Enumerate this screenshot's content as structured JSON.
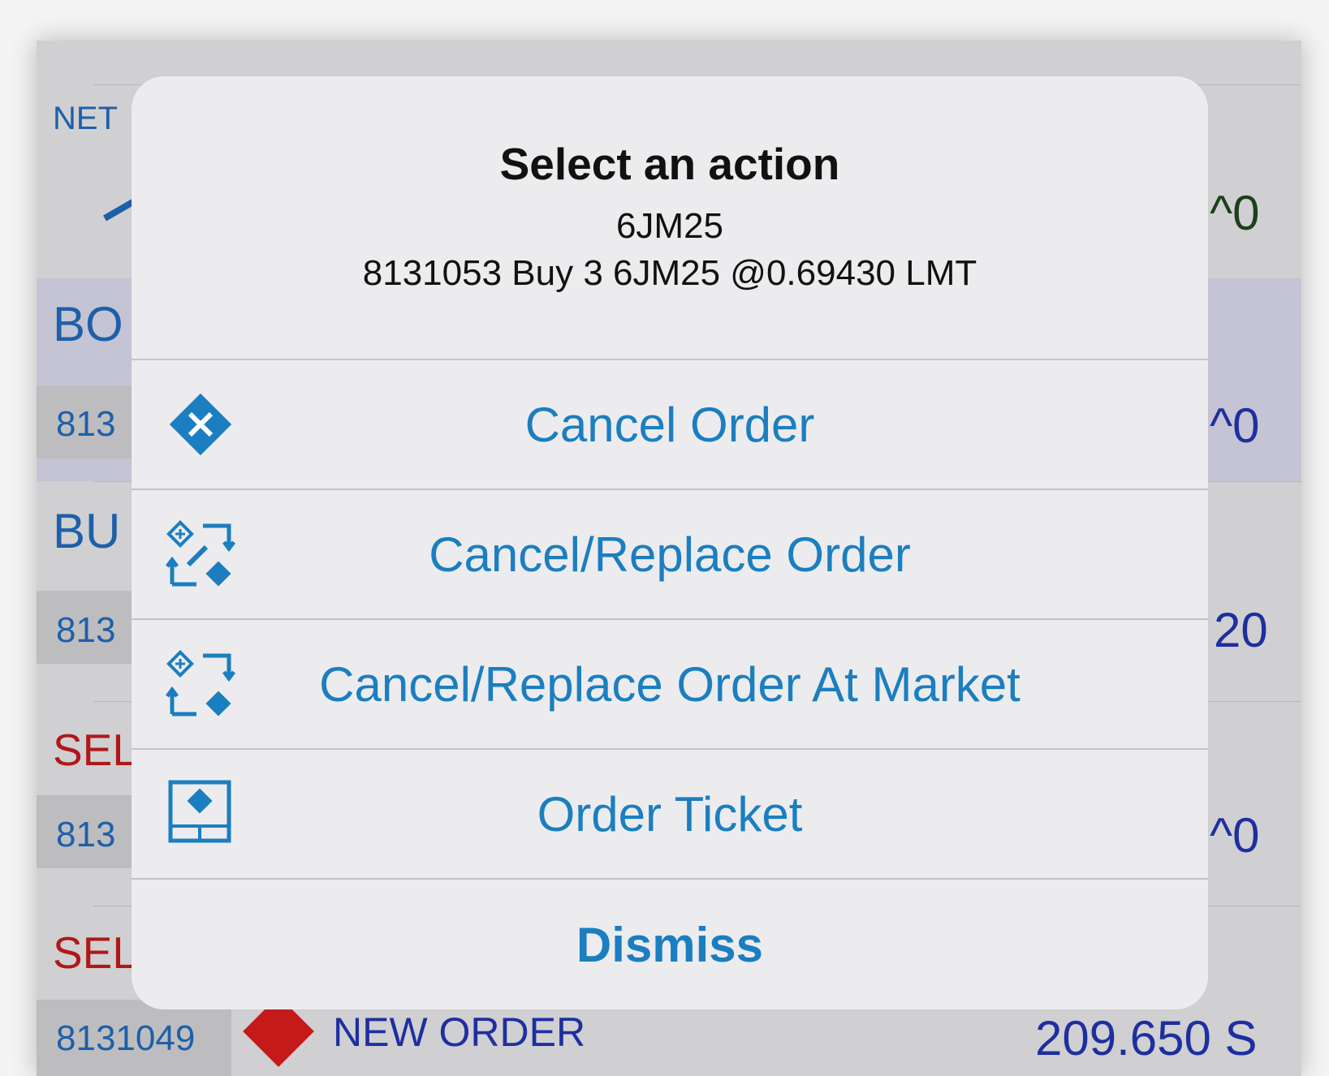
{
  "background": {
    "net_label": "NET",
    "right_values": [
      "^0",
      "^0",
      "20",
      "^0"
    ],
    "section_labels": [
      "BO",
      "BU",
      "SEL",
      "SEL"
    ],
    "row_ids": [
      "813",
      "813",
      "813",
      "8131049"
    ],
    "last_row": {
      "status": "NEW ORDER",
      "value": "209.650 S"
    }
  },
  "dialog": {
    "title": "Select an action",
    "symbol": "6JM25",
    "order_summary": "8131053 Buy 3 6JM25 @0.69430 LMT",
    "actions": [
      {
        "label": "Cancel Order",
        "icon": "cancel-diamond-icon"
      },
      {
        "label": "Cancel/Replace Order",
        "icon": "replace-edit-icon"
      },
      {
        "label": "Cancel/Replace Order At Market",
        "icon": "replace-market-icon"
      },
      {
        "label": "Order Ticket",
        "icon": "order-ticket-icon"
      }
    ],
    "dismiss_label": "Dismiss"
  },
  "colors": {
    "accent_blue": "#1b7ec0",
    "sell_red": "#b01818",
    "order_red_diamond": "#c41a1a"
  }
}
